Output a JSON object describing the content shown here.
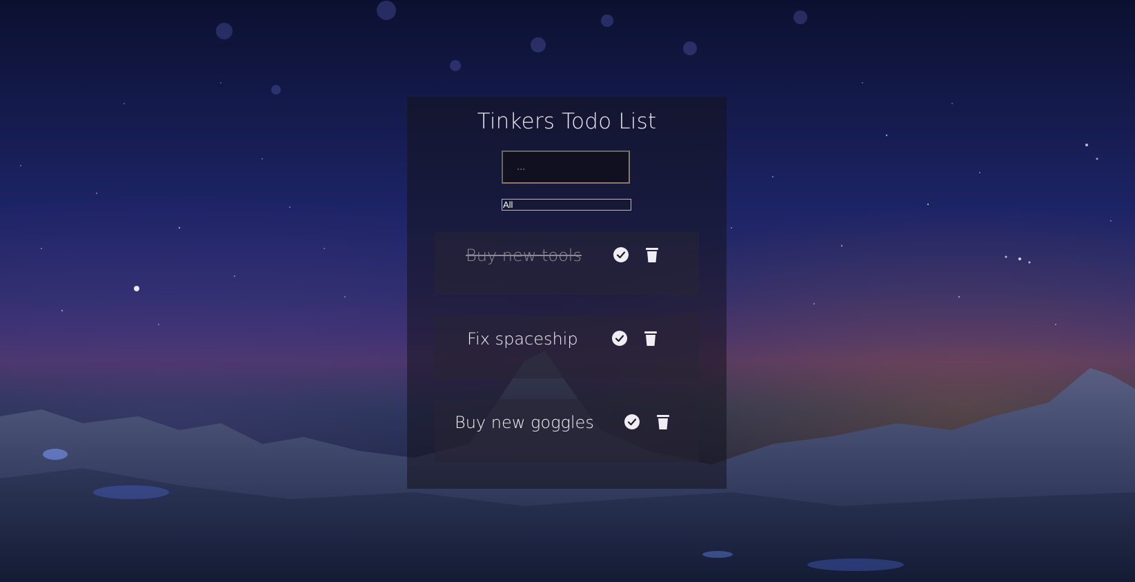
{
  "app": {
    "title": "Tinkers Todo List"
  },
  "input": {
    "placeholder": "...",
    "value": ""
  },
  "filter": {
    "selected": "All"
  },
  "todos": [
    {
      "text": "Buy new tools",
      "completed": true,
      "check_icon": "check-circle-icon",
      "delete_icon": "trash-icon"
    },
    {
      "text": "Fix spaceship",
      "completed": false,
      "check_icon": "check-circle-icon",
      "delete_icon": "trash-icon"
    },
    {
      "text": "Buy new goggles",
      "completed": false,
      "check_icon": "check-circle-icon",
      "delete_icon": "trash-icon"
    }
  ],
  "colors": {
    "panel": "#14121e",
    "text": "#f1eef4",
    "completed_text": "#8e8a93",
    "icon": "#f0eef2"
  }
}
